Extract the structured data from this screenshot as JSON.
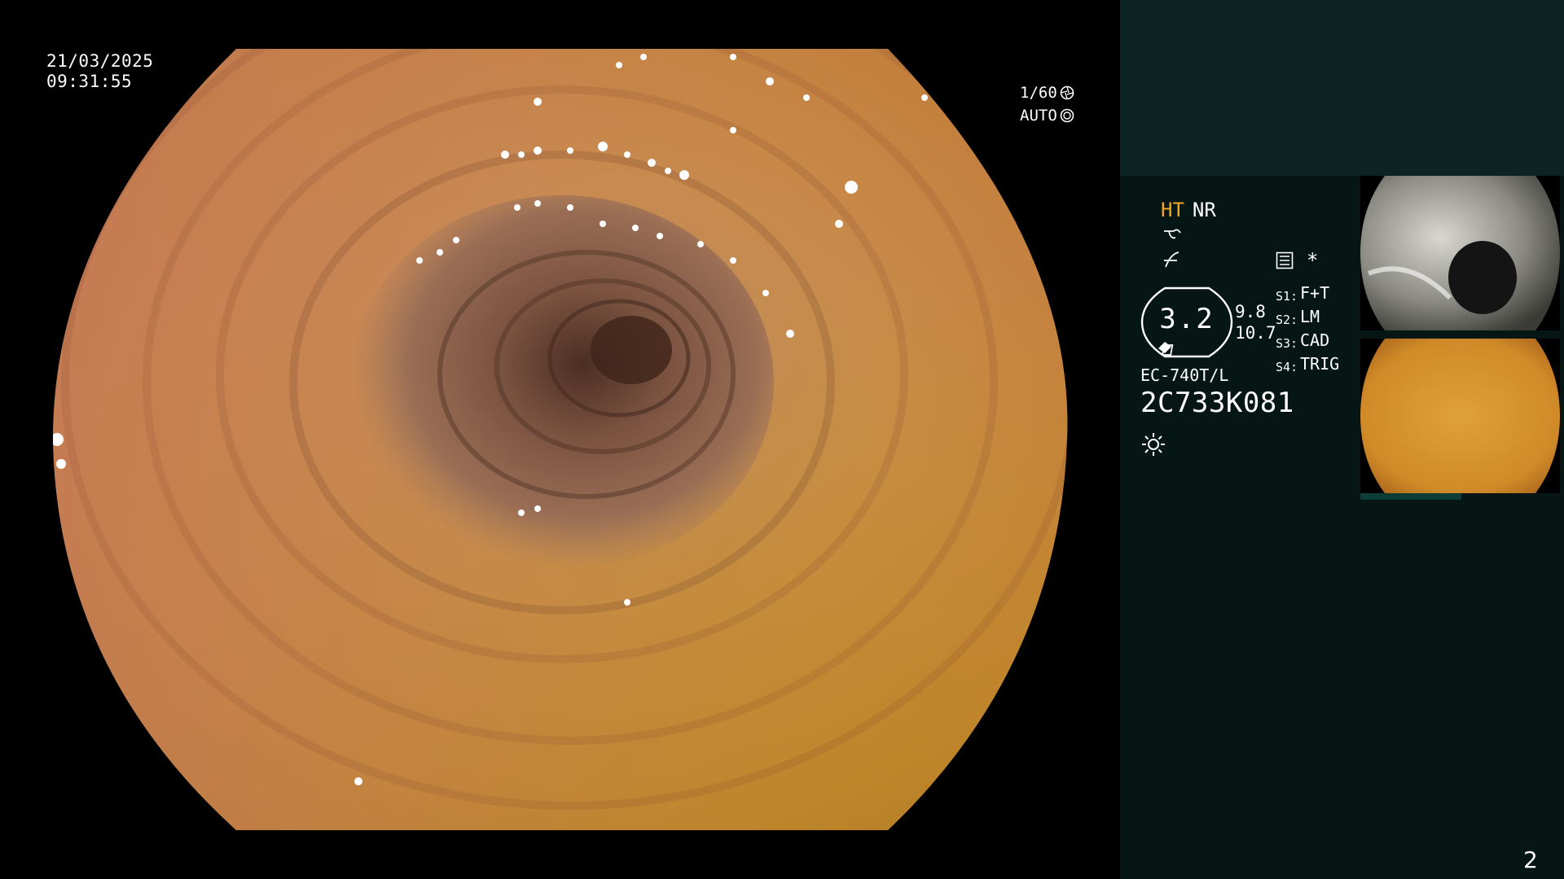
{
  "overlay": {
    "date": "21/03/2025",
    "time": "09:31:55",
    "shutter": "1/60",
    "iris": "AUTO",
    "shutter_icon": "aperture-icon",
    "iris_icon": "iris-icon"
  },
  "panel": {
    "mode_ht": "HT",
    "mode_nr": "NR",
    "enhancement_value": "3.2",
    "side_value_top": "9.8",
    "side_value_bottom": "10.7",
    "switches": [
      {
        "key": "S1:",
        "value": "F+T"
      },
      {
        "key": "S2:",
        "value": "LM"
      },
      {
        "key": "S3:",
        "value": "CAD"
      },
      {
        "key": "S4:",
        "value": "TRIG"
      }
    ],
    "asterisk": "*",
    "model": "EC-740T/L",
    "serial": "2C733K081",
    "page_number": "2",
    "colors": {
      "background": "#051614",
      "top_band": "#0c2424",
      "accent_ht": "#f5a623",
      "thumb_strip": "#0e3c36"
    }
  }
}
